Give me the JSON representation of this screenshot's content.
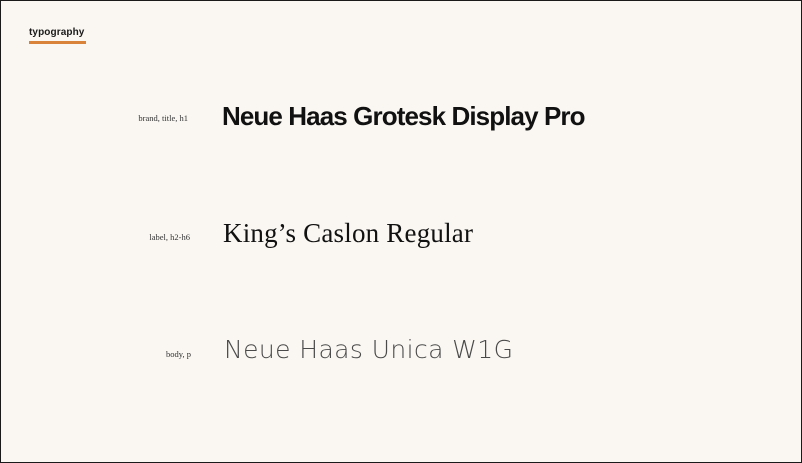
{
  "section": {
    "tag": "typography",
    "accent_color": "#d9833a"
  },
  "rows": [
    {
      "role": "brand, title, h1",
      "sample": "Neue Haas Grotesk Display Pro"
    },
    {
      "role": "label, h2-h6",
      "sample": "King’s Caslon Regular"
    },
    {
      "role": "body, p",
      "sample": "Neue Haas Unica W1G"
    }
  ],
  "colors": {
    "background": "#faf7f2",
    "border": "#1a1a1a",
    "text": "#111111"
  }
}
